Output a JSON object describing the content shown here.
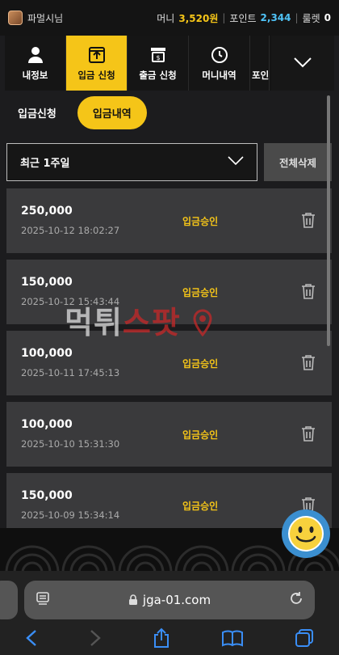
{
  "header": {
    "user": "파멀시님",
    "money_label": "머니",
    "money_value": "3,520원",
    "point_label": "포인트",
    "point_value": "2,344",
    "roulette_label": "룰렛",
    "roulette_value": "0"
  },
  "tabs": [
    {
      "label": "내정보",
      "icon": "user-icon"
    },
    {
      "label": "입금 신청",
      "icon": "deposit-icon",
      "active": true
    },
    {
      "label": "출금 신청",
      "icon": "withdraw-icon"
    },
    {
      "label": "머니내역",
      "icon": "clock-icon"
    },
    {
      "label": "포인",
      "icon": ""
    }
  ],
  "subtabs": {
    "apply": "입금신청",
    "history": "입금내역"
  },
  "filter": {
    "period": "최근 1주일",
    "delete_all": "전체삭제"
  },
  "deposits": [
    {
      "amount": "250,000",
      "date": "2025-10-12 18:02:27",
      "status": "입금승인"
    },
    {
      "amount": "150,000",
      "date": "2025-10-12 15:43:44",
      "status": "입금승인"
    },
    {
      "amount": "100,000",
      "date": "2025-10-11 17:45:13",
      "status": "입금승인"
    },
    {
      "amount": "100,000",
      "date": "2025-10-10 15:31:30",
      "status": "입금승인"
    },
    {
      "amount": "150,000",
      "date": "2025-10-09 15:34:14",
      "status": "입금승인"
    }
  ],
  "watermark": {
    "part1": "먹튀",
    "part2": "스팟"
  },
  "browser": {
    "url": "jga-01.com"
  },
  "colors": {
    "accent": "#f5c518",
    "point": "#4fc3f7",
    "row_bg": "#3a3a3c",
    "watermark_red": "#c62828"
  }
}
